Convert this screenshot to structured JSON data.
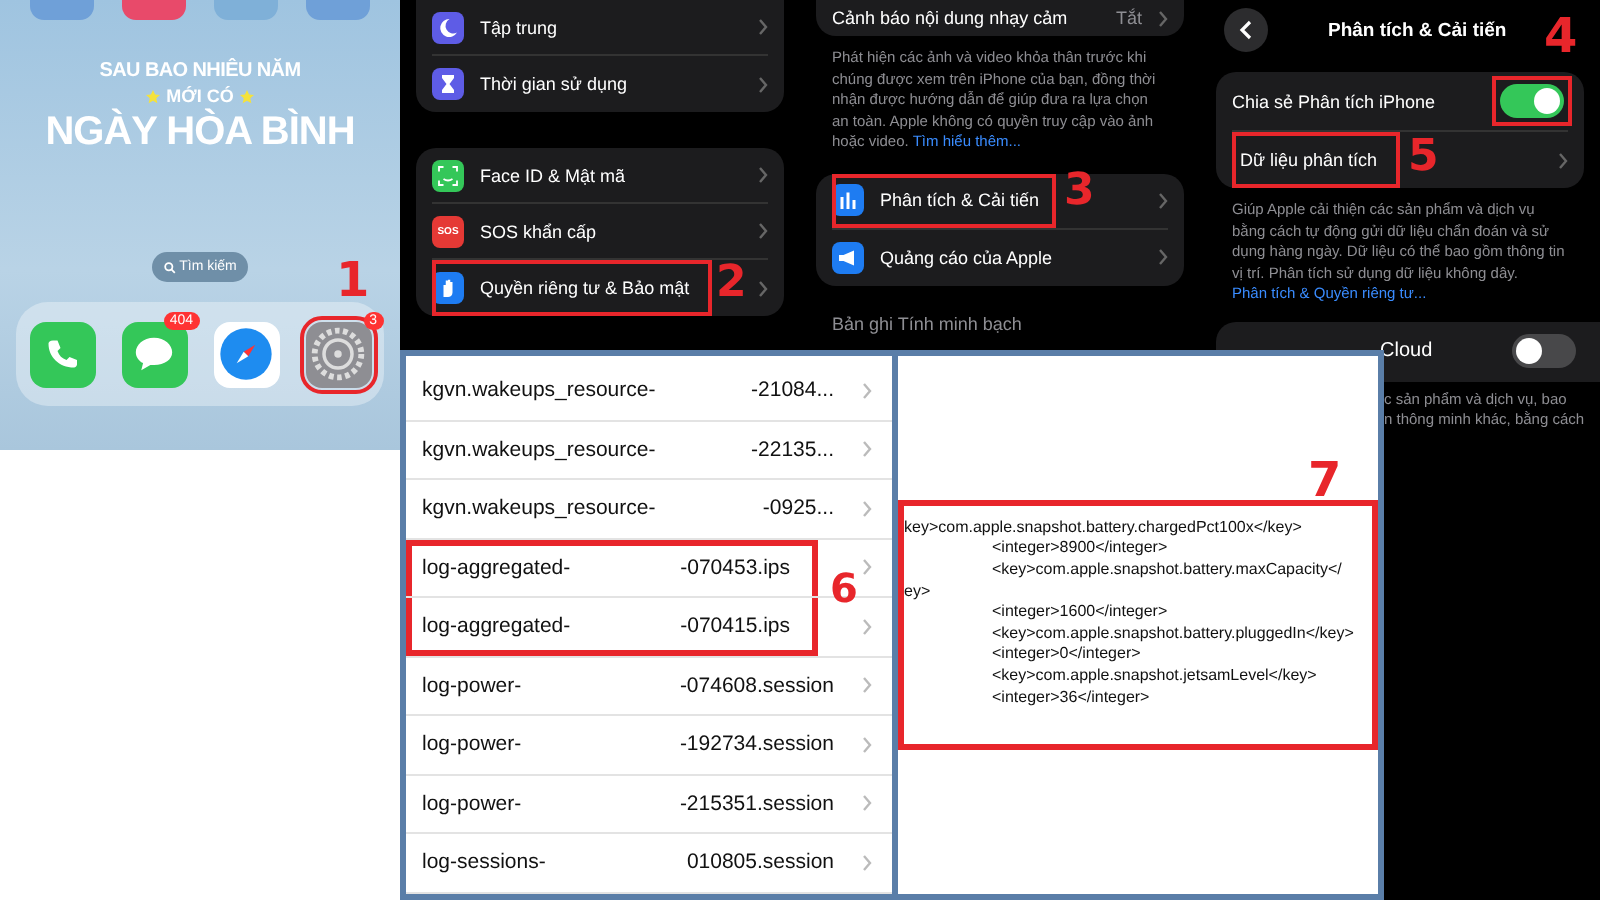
{
  "home_screen": {
    "wallpaper_text": {
      "line_1": "SAU BAO NHIÊU NĂM",
      "line_2": "MỚI CÓ",
      "line_3": "NGÀY HÒA BÌNH"
    },
    "search": {
      "label": "Tìm kiếm"
    },
    "dock": [
      {
        "kind": "phone",
        "highlighted": false
      },
      {
        "kind": "messages",
        "badge": "404",
        "highlighted": false
      },
      {
        "kind": "safari",
        "highlighted": false
      },
      {
        "kind": "settings",
        "badge": "3",
        "highlighted": true
      }
    ],
    "callout": "1"
  },
  "settings_list": {
    "groups": [
      [
        {
          "label": "Tập trung",
          "kind": "moon",
          "highlighted": false
        },
        {
          "label": "Thời gian sử dụng",
          "kind": "hourglass",
          "highlighted": false
        }
      ],
      [
        {
          "label": "Face ID & Mật mã",
          "kind": "face",
          "highlighted": false
        },
        {
          "label": "SOS khẩn cấp",
          "kind": "sos",
          "icon_text": "SOS",
          "highlighted": false
        },
        {
          "label": "Quyền riêng tư & Bảo mật",
          "kind": "hand",
          "highlighted": true
        }
      ]
    ],
    "callout": "2"
  },
  "privacy_list": {
    "top_row": {
      "label": "Cảnh báo nội dung nhạy cảm",
      "value": "Tắt"
    },
    "description": "Phát hiện các ảnh và video khỏa thân trước khi chúng được xem trên iPhone của bạn, đồng thời nhận được hướng dẫn để giúp đưa ra lựa chọn an toàn. Apple không có quyền truy cập vào ảnh hoặc video.",
    "link": "Tìm hiểu thêm...",
    "rows": [
      {
        "label": "Phân tích & Cải tiến",
        "kind": "chart",
        "highlighted": true
      },
      {
        "label": "Quảng cáo của Apple",
        "kind": "megaphone",
        "highlighted": false
      }
    ],
    "section_header": "Bản ghi Tính minh bạch",
    "callout": "3"
  },
  "analytics": {
    "title": "Phân tích & Cải tiến",
    "share_toggle": {
      "label": "Chia sẻ Phân tích iPhone",
      "on": true,
      "highlighted": true,
      "callout": "4"
    },
    "data_row": {
      "label": "Dữ liệu phân tích",
      "highlighted": true,
      "callout": "5"
    },
    "description": "Giúp Apple cải thiện các sản phẩm và dịch vụ bằng cách tự động gửi dữ liệu chẩn đoán và sử dụng hàng ngày. Dữ liệu có thể bao gồm thông tin vị trí. Phân tích sử dụng dữ liệu không dây.",
    "link": "Phân tích & Quyền riêng tư...",
    "cloud_toggle": {
      "label": "Cloud",
      "on": false
    },
    "cloud_text": [
      "c sản phẩm và dịch vụ, bao",
      "n thông minh khác, bằng cách"
    ]
  },
  "log_list": {
    "rows": [
      {
        "name": "kgvn.wakeups_resource-",
        "suffix": "-21084...",
        "highlighted": false
      },
      {
        "name": "kgvn.wakeups_resource-",
        "suffix": "-22135...",
        "highlighted": false
      },
      {
        "name": "kgvn.wakeups_resource-",
        "suffix": "-0925...",
        "highlighted": false
      },
      {
        "name": "log-aggregated-",
        "suffix": "-070453.ips",
        "highlighted": true
      },
      {
        "name": "log-aggregated-",
        "suffix": "-070415.ips",
        "highlighted": true
      },
      {
        "name": "log-power-",
        "suffix": "-074608.session",
        "highlighted": false
      },
      {
        "name": "log-power-",
        "suffix": "-192734.session",
        "highlighted": false
      },
      {
        "name": "log-power-",
        "suffix": "-215351.session",
        "highlighted": false
      },
      {
        "name": "log-sessions-",
        "suffix": "010805.session",
        "highlighted": false
      }
    ],
    "callout": "6"
  },
  "log_content": {
    "lines": [
      {
        "text": "key>com.apple.snapshot.battery.chargedPct100x</key>",
        "indent": false
      },
      {
        "text": "<integer>8900</integer>",
        "indent": true
      },
      {
        "text": "<key>com.apple.snapshot.battery.maxCapacity</",
        "indent": true
      },
      {
        "text": "ey>",
        "indent": false
      },
      {
        "text": "<integer>1600</integer>",
        "indent": true
      },
      {
        "text": "<key>com.apple.snapshot.battery.pluggedIn</key>",
        "indent": true
      },
      {
        "text": "<integer>0</integer>",
        "indent": true
      },
      {
        "text": "<key>com.apple.snapshot.jetsamLevel</key>",
        "indent": true
      },
      {
        "text": "<integer>36</integer>",
        "indent": true
      }
    ],
    "callout": "7"
  }
}
